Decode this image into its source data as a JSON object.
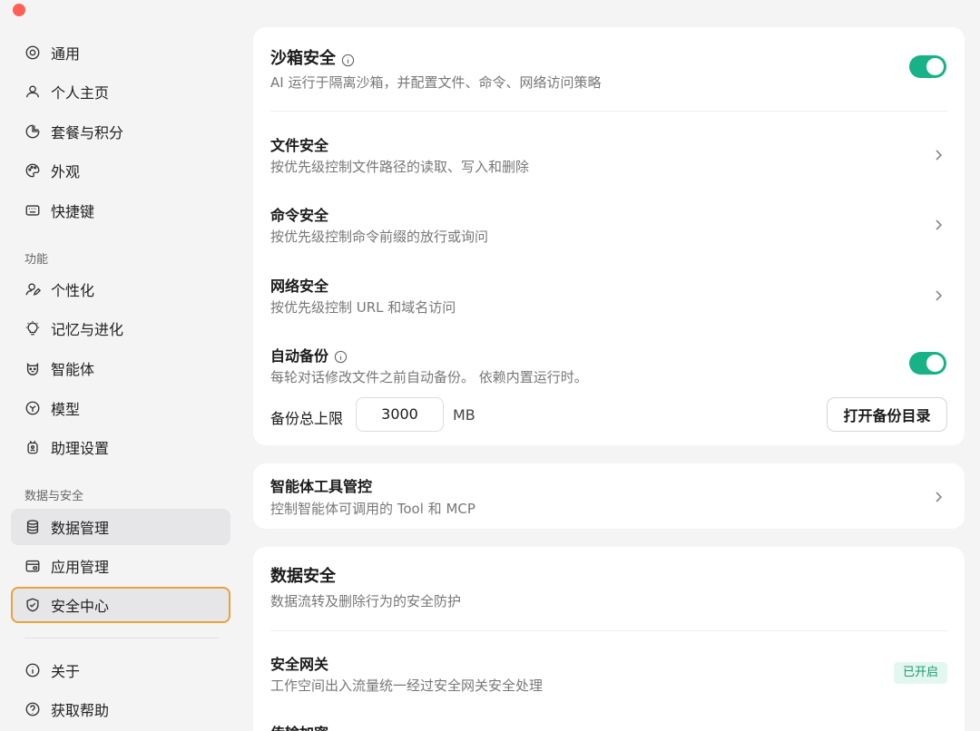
{
  "sidebar": {
    "items": [
      {
        "label": "通用",
        "icon": "settings-icon"
      },
      {
        "label": "个人主页",
        "icon": "user-icon"
      },
      {
        "label": "套餐与积分",
        "icon": "pie-icon"
      },
      {
        "label": "外观",
        "icon": "palette-icon"
      },
      {
        "label": "快捷键",
        "icon": "keyboard-icon"
      }
    ],
    "section_features": "功能",
    "features": [
      {
        "label": "个性化",
        "icon": "user-edit-icon"
      },
      {
        "label": "记忆与进化",
        "icon": "bulb-icon"
      },
      {
        "label": "智能体",
        "icon": "agent-icon"
      },
      {
        "label": "模型",
        "icon": "cube-icon"
      },
      {
        "label": "助理设置",
        "icon": "assistant-icon"
      }
    ],
    "section_data": "数据与安全",
    "data_items": [
      {
        "label": "数据管理",
        "icon": "database-icon"
      },
      {
        "label": "应用管理",
        "icon": "app-icon"
      },
      {
        "label": "安全中心",
        "icon": "shield-icon"
      }
    ],
    "bottom": [
      {
        "label": "关于",
        "icon": "info-icon"
      },
      {
        "label": "获取帮助",
        "icon": "help-icon"
      }
    ]
  },
  "sandbox": {
    "title": "沙箱安全",
    "desc": "AI 运行于隔离沙箱，并配置文件、命令、网络访问策略",
    "enabled": true
  },
  "file_security": {
    "title": "文件安全",
    "desc": "按优先级控制文件路径的读取、写入和删除"
  },
  "command_security": {
    "title": "命令安全",
    "desc": "按优先级控制命令前缀的放行或询问"
  },
  "network_security": {
    "title": "网络安全",
    "desc": "按优先级控制 URL 和域名访问"
  },
  "auto_backup": {
    "title": "自动备份",
    "desc": "每轮对话修改文件之前自动备份。 依赖内置运行时。",
    "enabled": true,
    "limit_label": "备份总上限",
    "limit_value": "3000",
    "limit_unit": "MB",
    "open_dir_button": "打开备份目录"
  },
  "agent_tools": {
    "title": "智能体工具管控",
    "desc": "控制智能体可调用的 Tool 和 MCP"
  },
  "data_security": {
    "title": "数据安全",
    "desc": "数据流转及删除行为的安全防护",
    "gateway_title": "安全网关",
    "gateway_desc": "工作空间出入流量统一经过安全网关安全处理",
    "gateway_status": "已开启",
    "next_title": "传输加密"
  },
  "colors": {
    "accent": "#17b287",
    "focus": "#e8a33a",
    "close": "#fe5f57"
  }
}
